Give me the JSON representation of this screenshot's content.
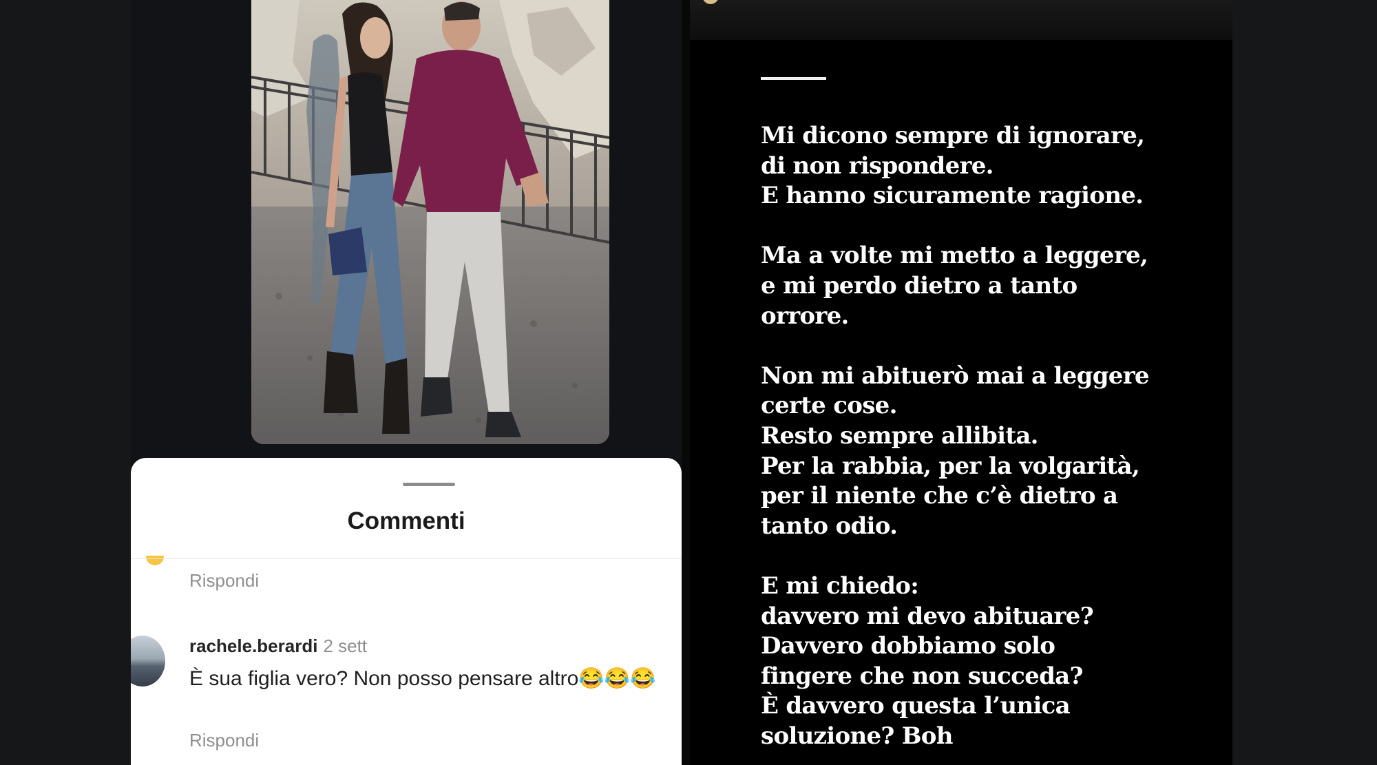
{
  "comments_sheet": {
    "title": "Commenti",
    "reply_label_1": "Rispondi",
    "comment": {
      "username": "rachele.berardi",
      "time": "2 sett",
      "text": "È sua figlia vero? Non posso pensare altro😂😂😂",
      "reply_label": "Rispondi"
    }
  },
  "story": {
    "stanzas": [
      [
        "Mi dicono sempre di ignorare,",
        "di non rispondere.",
        "E hanno sicuramente ragione."
      ],
      [
        "Ma a volte mi metto a leggere,",
        "e mi perdo dietro a tanto",
        "orrore."
      ],
      [
        "Non mi abituerò mai a leggere",
        "certe cose.",
        "Resto sempre allibita.",
        "Per la rabbia, per la volgarità,",
        "per il niente che c’è dietro a",
        "tanto odio."
      ],
      [
        "E mi chiedo:",
        "davvero mi devo abituare?",
        "Davvero dobbiamo solo",
        "fingere che non succeda?",
        "È davvero questa l’unica",
        "soluzione? Boh"
      ]
    ]
  },
  "colors": {
    "background": "#161719",
    "story_background": "#000000",
    "sheet_background": "#ffffff",
    "muted_text": "#8e8e8e"
  }
}
